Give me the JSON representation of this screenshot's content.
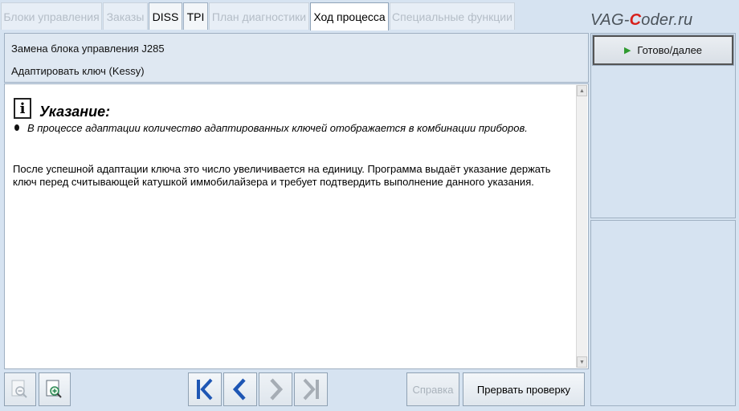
{
  "tabs": [
    {
      "label": "Блоки управления",
      "state": "disabled"
    },
    {
      "label": "Заказы",
      "state": "disabled"
    },
    {
      "label": "DISS",
      "state": "enabled"
    },
    {
      "label": "TPI",
      "state": "enabled"
    },
    {
      "label": "План диагностики",
      "state": "disabled"
    },
    {
      "label": "Ход процесса",
      "state": "active"
    },
    {
      "label": "Специальные функции",
      "state": "disabled"
    }
  ],
  "watermark": {
    "prefix": "VAG-",
    "accent": "C",
    "suffix": "oder.ru",
    "accent_color": "#d7201b"
  },
  "header": {
    "line1": "Замена блока управления J285",
    "line2": "Адаптировать ключ (Kessy)"
  },
  "content": {
    "note_icon": "info-icon",
    "note_title": "Указание:",
    "bullet_text": "В процессе адаптации количество адаптированных ключей отображается в комбинации приборов.",
    "paragraph": "После успешной адаптации ключа это число увеличивается на единицу. Программа выдаёт указание держать ключ перед считывающей катушкой иммобилайзера и требует подтвердить выполнение данного указания."
  },
  "side": {
    "next_label": "Готово/далее",
    "next_icon": "play-icon"
  },
  "toolbar": {
    "zoom_out_icon": "zoom-out-icon",
    "zoom_in_icon": "zoom-in-icon",
    "first_icon": "first-page-icon",
    "prev_icon": "previous-icon",
    "next_icon": "next-icon",
    "last_icon": "last-page-icon",
    "help_label": "Справка",
    "abort_label": "Прервать проверку"
  },
  "colors": {
    "background": "#d6e3f1",
    "nav_active": "#1e56b4",
    "nav_disabled": "#9aa3ad"
  }
}
